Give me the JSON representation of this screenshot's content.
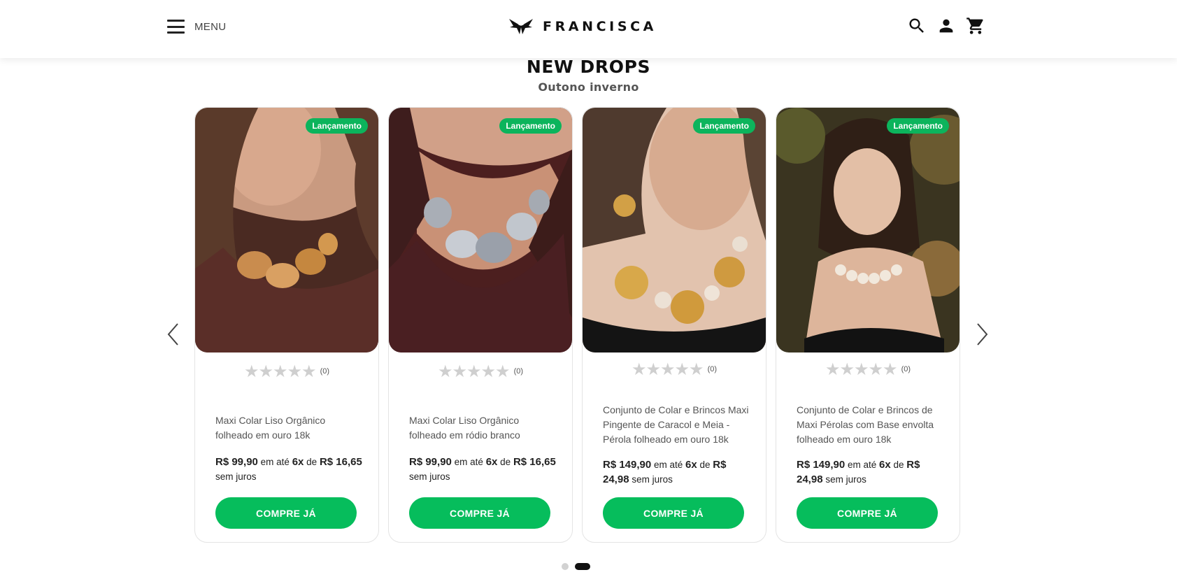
{
  "header": {
    "menu_label": "MENU",
    "brand": "FRANCISCA"
  },
  "section": {
    "title": "NEW DROPS",
    "subtitle": "Outono inverno"
  },
  "colors": {
    "accent_green": "#06bd5c",
    "badge_green": "#0cb45c"
  },
  "products": [
    {
      "badge": "Lançamento",
      "rating": 0,
      "rating_count": "(0)",
      "name": "Maxi Colar Liso Orgânico folheado em ouro 18k",
      "price": "R$ 99,90",
      "installment_text": "em até",
      "installments": "6x",
      "of": "de",
      "installment_value": "R$ 16,65",
      "interest": "sem juros",
      "cta": "COMPRE JÁ"
    },
    {
      "badge": "Lançamento",
      "rating": 0,
      "rating_count": "(0)",
      "name": "Maxi Colar Liso Orgânico folheado em ródio branco",
      "price": "R$ 99,90",
      "installment_text": "em até",
      "installments": "6x",
      "of": "de",
      "installment_value": "R$ 16,65",
      "interest": "sem juros",
      "cta": "COMPRE JÁ"
    },
    {
      "badge": "Lançamento",
      "rating": 0,
      "rating_count": "(0)",
      "name": "Conjunto de Colar e Brincos Maxi Pingente de Caracol e Meia - Pérola folheado em ouro 18k",
      "price": "R$ 149,90",
      "installment_text": "em até",
      "installments": "6x",
      "of": "de",
      "installment_value": "R$ 24,98",
      "interest": "sem juros",
      "cta": "COMPRE JÁ"
    },
    {
      "badge": "Lançamento",
      "rating": 0,
      "rating_count": "(0)",
      "name": "Conjunto de Colar e Brincos de Maxi Pérolas com Base envolta folheado em ouro 18k",
      "price": "R$ 149,90",
      "installment_text": "em até",
      "installments": "6x",
      "of": "de",
      "installment_value": "R$ 24,98",
      "interest": "sem juros",
      "cta": "COMPRE JÁ"
    }
  ],
  "pagination": {
    "pages": 2,
    "current": 2
  }
}
